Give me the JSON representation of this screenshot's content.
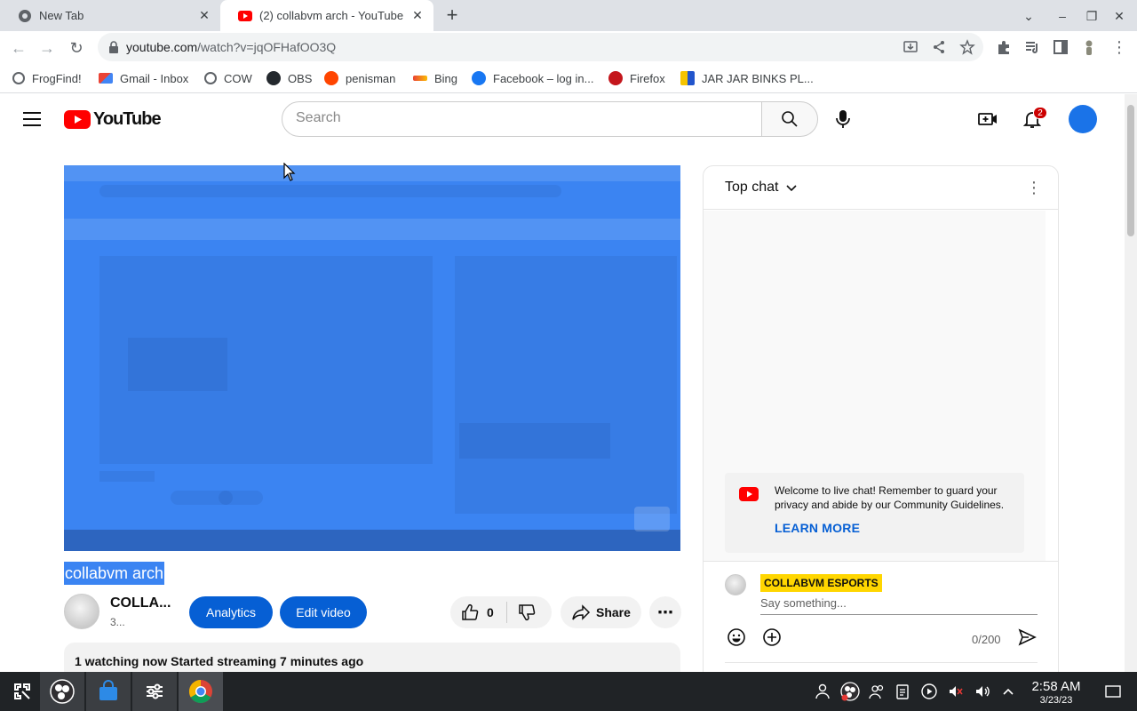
{
  "browser": {
    "tabs": [
      {
        "title": "New Tab",
        "active": false
      },
      {
        "title": "(2) collabvm arch - YouTube",
        "active": true
      }
    ],
    "url_host": "youtube.com",
    "url_path": "/watch?v=jqOFHafOO3Q",
    "bookmarks": [
      {
        "label": "FrogFind!",
        "icon": "globe-icon"
      },
      {
        "label": "Gmail - Inbox",
        "icon": "gmail-icon"
      },
      {
        "label": "COW",
        "icon": "globe-icon"
      },
      {
        "label": "OBS",
        "icon": "github-icon"
      },
      {
        "label": "penisman",
        "icon": "reddit-icon"
      },
      {
        "label": "Bing",
        "icon": "bing-icon"
      },
      {
        "label": "Facebook – log in...",
        "icon": "facebook-icon"
      },
      {
        "label": "Firefox",
        "icon": "firefox-icon"
      },
      {
        "label": "JAR JAR BINKS PL...",
        "icon": "bag-icon"
      }
    ]
  },
  "youtube": {
    "logo_text": "YouTube",
    "search_placeholder": "Search",
    "notification_count": "2",
    "video": {
      "title": "collabvm arch",
      "channel_name": "COLLA...",
      "channel_subs": "3...",
      "analytics_label": "Analytics",
      "edit_label": "Edit video",
      "like_count": "0",
      "share_label": "Share",
      "description": "1 watching now  Started streaming 7 minutes ago"
    },
    "chat": {
      "title": "Top chat",
      "welcome_text": "Welcome to live chat! Remember to guard your privacy and abide by our Community Guidelines.",
      "learn_more": "LEARN MORE",
      "username": "COLLABVM ESPORTS",
      "input_placeholder": "Say something...",
      "char_count": "0/200"
    }
  },
  "taskbar": {
    "time": "2:58 AM",
    "date": "3/23/23"
  },
  "colors": {
    "youtube_red": "#ff0000",
    "youtube_blue": "#065fd4",
    "selection_blue": "#3b84f2",
    "username_highlight": "#ffd600"
  }
}
